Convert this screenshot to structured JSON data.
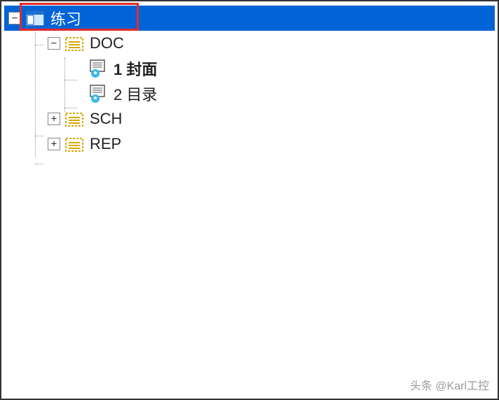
{
  "tree": {
    "root": {
      "label": "练习",
      "expanded": true,
      "children": [
        {
          "key": "doc",
          "label": "DOC",
          "expanded": true,
          "children": [
            {
              "key": "page1",
              "label": "1 封面",
              "bold": true
            },
            {
              "key": "page2",
              "label": "2 目录",
              "bold": false
            }
          ]
        },
        {
          "key": "sch",
          "label": "SCH",
          "expanded": false
        },
        {
          "key": "rep",
          "label": "REP",
          "expanded": false
        }
      ]
    }
  },
  "toggles": {
    "minus": "−",
    "plus": "+"
  },
  "watermark": "头条 @Karl工控"
}
